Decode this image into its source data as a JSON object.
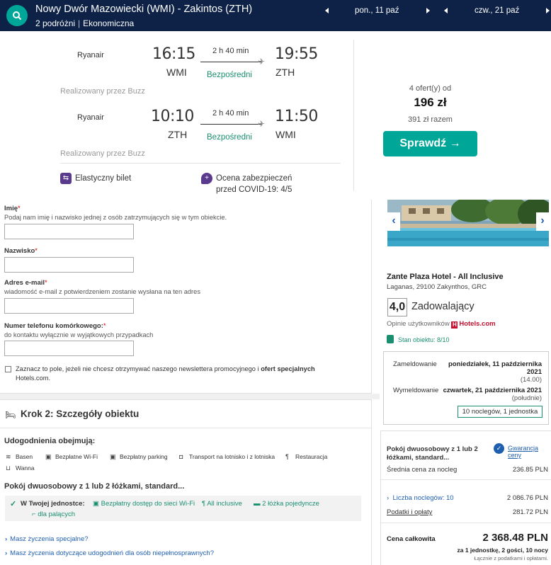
{
  "header": {
    "route": "Nowy Dwór Mazowiecki (WMI) - Zakintos (ZTH)",
    "travellers": "2 podróżni",
    "cabin": "Ekonomiczna",
    "depart_date": "pon., 11 paź",
    "return_date": "czw., 21 paź",
    "colors": {
      "bar": "#0d2246",
      "accent": "#00a698"
    }
  },
  "flight": {
    "outbound": {
      "airline": "Ryanair",
      "dep_time": "16:15",
      "dep_airport": "WMI",
      "duration": "2 h 40 min",
      "stops": "Bezpośredni",
      "arr_time": "19:55",
      "arr_airport": "ZTH",
      "operated_by": "Realizowany przez Buzz"
    },
    "return": {
      "airline": "Ryanair",
      "dep_time": "10:10",
      "dep_airport": "ZTH",
      "duration": "2 h 40 min",
      "stops": "Bezpośredni",
      "arr_time": "11:50",
      "arr_airport": "WMI",
      "operated_by": "Realizowany przez Buzz"
    },
    "features": {
      "flexible": "Elastyczny bilet",
      "covid_line1": "Ocena zabezpieczeń",
      "covid_line2": "przed COVID-19: 4/5"
    },
    "offer": {
      "count": "4 ofert(y) od",
      "price": "196 zł",
      "total": "391 zł razem",
      "button": "Sprawdź →"
    }
  },
  "form": {
    "first_name": {
      "label": "Imię",
      "required": "*",
      "hint": "Podaj nam imię i nazwisko jednej z osób zatrzymujących się w tym obiekcie."
    },
    "last_name": {
      "label": "Nazwisko",
      "required": "*"
    },
    "email": {
      "label": "Adres e-mail",
      "required": "*",
      "hint": "wiadomość e-mail z potwierdzeniem zostanie wysłana na ten adres"
    },
    "phone": {
      "label": "Numer telefonu komórkowego:",
      "required": "*",
      "hint": "do kontaktu wyłącznie w wyjątkowych przypadkach"
    },
    "newsletter": {
      "text_before": "Zaznacz to pole, jeżeli nie chcesz otrzymywać naszego newslettera promocyjnego i ",
      "text_bold": "ofert specjalnych",
      "text_after": "Hotels.com."
    }
  },
  "step2": {
    "title": "Krok 2: Szczegóły obiektu",
    "amenities_title": "Udogodnienia obejmują:",
    "amenities": [
      {
        "icon": "pool-icon",
        "label": "Basen"
      },
      {
        "icon": "wifi-icon",
        "label": "Bezpłatne Wi-Fi"
      },
      {
        "icon": "parking-icon",
        "label": "Bezpłatny parking"
      },
      {
        "icon": "shuttle-icon",
        "label": "Transport na lotnisko i z lotniska"
      },
      {
        "icon": "restaurant-icon",
        "label": "Restauracja"
      },
      {
        "icon": "bathtub-icon",
        "label": "Wanna"
      }
    ],
    "room_title": "Pokój dwuosobowy z 1 lub 2 łóżkami, standard...",
    "in_unit_label": "W Twojej jednostce:",
    "room_features": [
      {
        "icon": "wifi-icon",
        "label": "Bezpłatny dostęp do sieci Wi-Fi"
      },
      {
        "icon": "restaurant-icon",
        "label": "All inclusive"
      },
      {
        "icon": "bed-icon",
        "label": "2 łóżka pojedyncze"
      },
      {
        "icon": "smoking-icon",
        "label": "dla palących"
      }
    ],
    "links": [
      "Masz życzenia specjalne?",
      "Masz życzenia dotyczące udogodnień dla osób niepełnosprawnych?"
    ]
  },
  "hotel": {
    "name": "Zante Plaza Hotel - All Inclusive",
    "address": "Laganas, 29100 Zakynthos, GRC",
    "score": "4,0",
    "score_label": "Zadowalający",
    "reviews_prefix": "Opinie użytkowników",
    "reviews_brand": "Hotels.com",
    "condition": "Stan obiektu: 8/10",
    "checkin_label": "Zameldowanie",
    "checkin_date_1": "poniedziałek, 11 października",
    "checkin_date_2": "2021",
    "checkin_time": "(14.00)",
    "checkout_label": "Wymeldowanie",
    "checkout_date": "czwartek, 21 października 2021",
    "checkout_time": "(południe)",
    "nights": "10 noclegów, 1 jednostka"
  },
  "pricing": {
    "room_line1": "Pokój dwuosobowy z 1 lub 2",
    "room_line2": "łóżkami, standard...",
    "guarantee": "Gwarancja ceny",
    "avg_label": "Średnia cena za nocleg",
    "avg_value": "236.85 PLN",
    "nights_label": "Liczba noclegów: 10",
    "nights_value": "2 086.76 PLN",
    "taxes_label": "Podatki i opłaty",
    "taxes_value": "281.72 PLN",
    "total_label": "Cena całkowita",
    "total_value": "2 368.48 PLN",
    "total_note": "za 1 jednostkę, 2 gości, 10 nocy",
    "total_note2": "Łącznie z podatkami i opłatami."
  }
}
